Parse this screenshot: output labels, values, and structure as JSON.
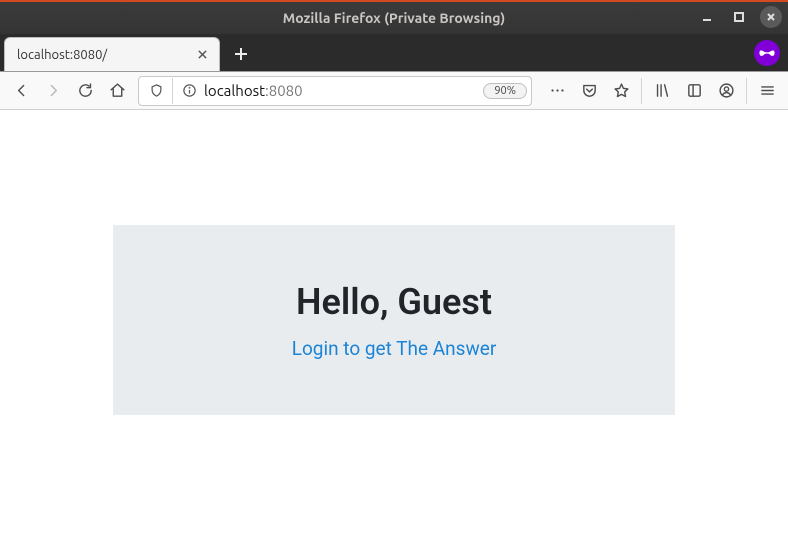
{
  "window": {
    "title": "Mozilla Firefox (Private Browsing)"
  },
  "tabs": {
    "active_label": "localhost:8080/"
  },
  "url": {
    "host_strong": "localhost",
    "rest": ":8080",
    "zoom": "90%"
  },
  "page": {
    "greeting": "Hello, Guest",
    "login_link": "Login to get The Answer"
  }
}
